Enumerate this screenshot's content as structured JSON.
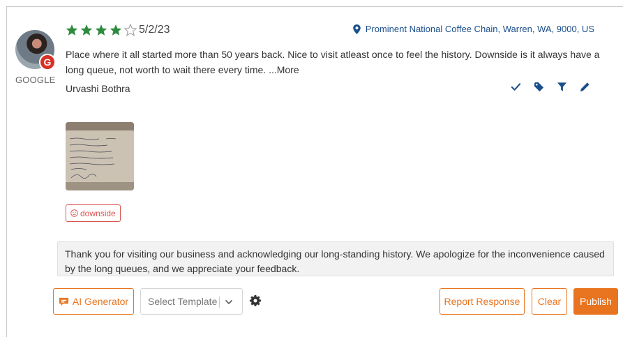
{
  "review": {
    "rating": 4,
    "max_rating": 5,
    "date": "5/2/23",
    "location": "Prominent National Coffee Chain, Warren, WA, 9000, US",
    "text": "Place where it all started more than 50 years back. Nice to visit atleast once to feel the history. Downside is it always have a long queue, not worth to wait there every time.",
    "more_label": "...More",
    "author": "Urvashi Bothra",
    "source": "GOOGLE",
    "source_badge_letter": "G",
    "tag": "downside"
  },
  "response": {
    "text": "Thank you for visiting our business and acknowledging our long-standing history. We apologize for the inconvenience caused by the long queues, and we appreciate your feedback."
  },
  "toolbar": {
    "ai_generator_label": "AI Generator",
    "template_placeholder": "Select Template",
    "report_label": "Report Response",
    "clear_label": "Clear",
    "publish_label": "Publish"
  },
  "icons": {
    "star": "star-icon",
    "pin": "map-pin-icon",
    "actions": [
      "check-icon",
      "tag-icon",
      "filter-icon",
      "pencil-icon"
    ],
    "tag_chip": "frown-icon",
    "ai": "chat-icon",
    "template": "chevron-down-icon",
    "settings": "gear-icon"
  },
  "colors": {
    "star_filled": "#2e8b3e",
    "star_empty": "#999999",
    "location": "#1a4f8b",
    "action_icons": "#1a4f8b",
    "accent": "#e8741f",
    "tag_negative": "#d9534f",
    "google_badge": "#d93025"
  }
}
